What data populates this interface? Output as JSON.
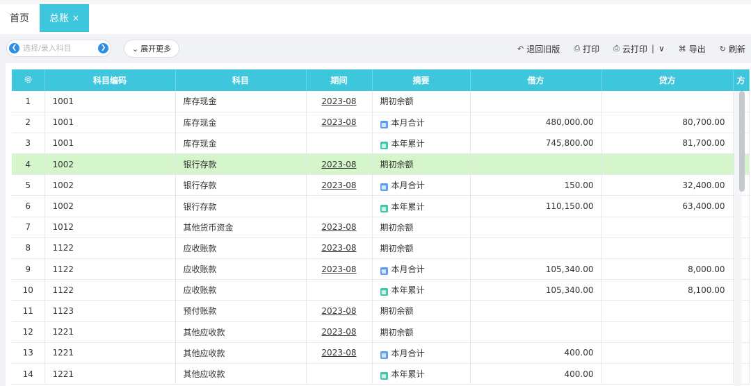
{
  "tabs": [
    {
      "label": "首页"
    },
    {
      "label": "总账",
      "close": "×"
    }
  ],
  "search": {
    "placeholder": "选择/录入科目",
    "prev_icon": "chevron-left-circle",
    "next_icon": "chevron-right-circle"
  },
  "expand": {
    "label": "展开更多",
    "icon": "chevron-down"
  },
  "actions": [
    {
      "icon": "undo",
      "glyph": "↶",
      "label": "退回旧版"
    },
    {
      "icon": "printer",
      "glyph": "⎙",
      "label": "打印"
    },
    {
      "icon": "cloud-printer",
      "glyph": "⎙",
      "label": "云打印",
      "sep": "|",
      "caret": "∨"
    },
    {
      "icon": "export",
      "glyph": "⌘",
      "label": "导出"
    },
    {
      "icon": "refresh",
      "glyph": "↻",
      "label": "刷新"
    }
  ],
  "table": {
    "settings_icon": "gear",
    "columns": [
      "科目编码",
      "科目",
      "期间",
      "摘要",
      "借方",
      "贷方",
      "方"
    ],
    "rows": [
      {
        "idx": "1",
        "code": "1001",
        "subject": "库存现金",
        "period": "2023-08",
        "summary": "期初余额",
        "badge": "",
        "debit": "",
        "credit": ""
      },
      {
        "idx": "2",
        "code": "1001",
        "subject": "库存现金",
        "period": "2023-08",
        "summary": "本月合计",
        "badge": "blue",
        "debit": "480,000.00",
        "credit": "80,700.00"
      },
      {
        "idx": "3",
        "code": "1001",
        "subject": "库存现金",
        "period": "",
        "summary": "本年累计",
        "badge": "green",
        "debit": "745,800.00",
        "credit": "81,700.00"
      },
      {
        "idx": "4",
        "code": "1002",
        "subject": "银行存款",
        "period": "2023-08",
        "summary": "期初余额",
        "badge": "",
        "debit": "",
        "credit": "",
        "highlight": true
      },
      {
        "idx": "5",
        "code": "1002",
        "subject": "银行存款",
        "period": "2023-08",
        "summary": "本月合计",
        "badge": "blue",
        "debit": "150.00",
        "credit": "32,400.00"
      },
      {
        "idx": "6",
        "code": "1002",
        "subject": "银行存款",
        "period": "",
        "summary": "本年累计",
        "badge": "green",
        "debit": "110,150.00",
        "credit": "63,400.00"
      },
      {
        "idx": "7",
        "code": "1012",
        "subject": "其他货币资金",
        "period": "2023-08",
        "summary": "期初余额",
        "badge": "",
        "debit": "",
        "credit": ""
      },
      {
        "idx": "8",
        "code": "1122",
        "subject": "应收账款",
        "period": "2023-08",
        "summary": "期初余额",
        "badge": "",
        "debit": "",
        "credit": ""
      },
      {
        "idx": "9",
        "code": "1122",
        "subject": "应收账款",
        "period": "2023-08",
        "summary": "本月合计",
        "badge": "blue",
        "debit": "105,340.00",
        "credit": "8,000.00"
      },
      {
        "idx": "10",
        "code": "1122",
        "subject": "应收账款",
        "period": "",
        "summary": "本年累计",
        "badge": "green",
        "debit": "105,340.00",
        "credit": "8,100.00"
      },
      {
        "idx": "11",
        "code": "1123",
        "subject": "预付账款",
        "period": "2023-08",
        "summary": "期初余额",
        "badge": "",
        "debit": "",
        "credit": ""
      },
      {
        "idx": "12",
        "code": "1221",
        "subject": "其他应收款",
        "period": "2023-08",
        "summary": "期初余额",
        "badge": "",
        "debit": "",
        "credit": ""
      },
      {
        "idx": "13",
        "code": "1221",
        "subject": "其他应收款",
        "period": "2023-08",
        "summary": "本月合计",
        "badge": "blue",
        "debit": "400.00",
        "credit": ""
      },
      {
        "idx": "14",
        "code": "1221",
        "subject": "其他应收款",
        "period": "",
        "summary": "本年累计",
        "badge": "green",
        "debit": "400.00",
        "credit": ""
      }
    ]
  },
  "colors": {
    "accent": "#3ec7dc",
    "highlight_row": "#d5f5cb",
    "link_blue": "#2f8ee8"
  }
}
